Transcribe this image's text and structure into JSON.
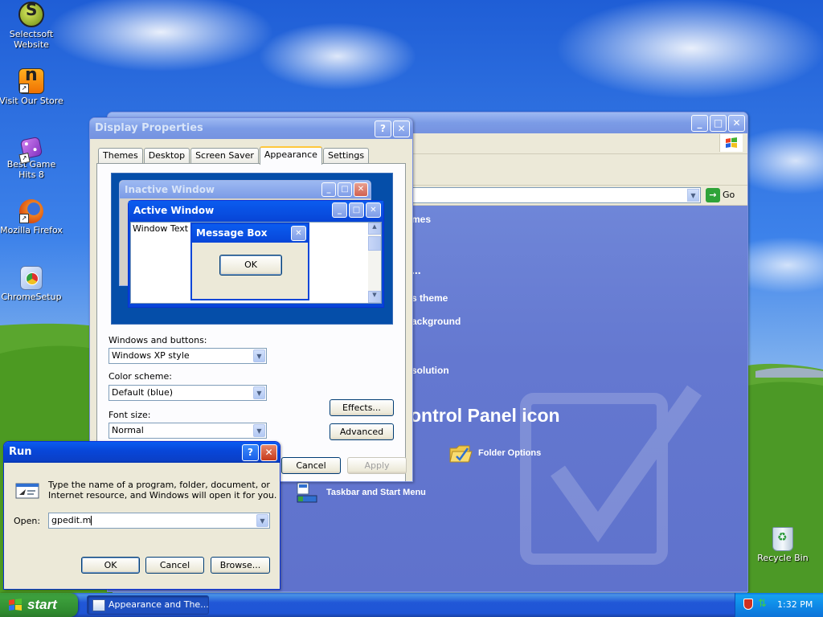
{
  "desktop": {
    "icons": [
      {
        "label": "Selectsoft Website",
        "icon": "selectsoft-logo-icon"
      },
      {
        "label": "Visit Our Store",
        "icon": "store-shortcut-icon"
      },
      {
        "label": "Best Game Hits 8",
        "icon": "dice-icon"
      },
      {
        "label": "Mozilla Firefox",
        "icon": "firefox-icon"
      },
      {
        "label": "ChromeSetup",
        "icon": "chrome-setup-icon"
      },
      {
        "label": "Recycle Bin",
        "icon": "recycle-bin-icon"
      }
    ]
  },
  "control_panel": {
    "go_label": "Go",
    "links": [
      "mes",
      "...",
      "s theme",
      "ackground",
      "solution"
    ],
    "section_title": "ontrol Panel icon",
    "icons": [
      {
        "label": "Folder Options",
        "icon": "folder-options-icon"
      },
      {
        "label": "Taskbar and Start Menu",
        "icon": "taskbar-start-menu-icon"
      }
    ]
  },
  "display_properties": {
    "title": "Display Properties",
    "tabs": [
      "Themes",
      "Desktop",
      "Screen Saver",
      "Appearance",
      "Settings"
    ],
    "active_tab": "Appearance",
    "preview": {
      "inactive_title": "Inactive Window",
      "active_title": "Active Window",
      "window_text": "Window Text",
      "msgbox_title": "Message Box",
      "msgbox_ok": "OK"
    },
    "windows_buttons_label": "Windows and buttons:",
    "windows_buttons_value": "Windows XP style",
    "color_scheme_label": "Color scheme:",
    "color_scheme_value": "Default (blue)",
    "font_size_label": "Font size:",
    "font_size_value": "Normal",
    "effects_label": "Effects...",
    "advanced_label": "Advanced",
    "cancel_label": "Cancel",
    "apply_label": "Apply"
  },
  "run": {
    "title": "Run",
    "description_line1": "Type the name of a program, folder, document, or",
    "description_line2": "Internet resource, and Windows will open it for you.",
    "open_label": "Open:",
    "open_value": "gpedit.m",
    "ok_label": "OK",
    "cancel_label": "Cancel",
    "browse_label": "Browse..."
  },
  "taskbar": {
    "start_label": "start",
    "task_label": "Appearance and The...",
    "clock": "1:32 PM"
  },
  "colors": {
    "title_blue": "#0846d8",
    "start_green": "#3c9f3c",
    "cp_content": "#6478d0",
    "dialog_face": "#ece9d8"
  }
}
